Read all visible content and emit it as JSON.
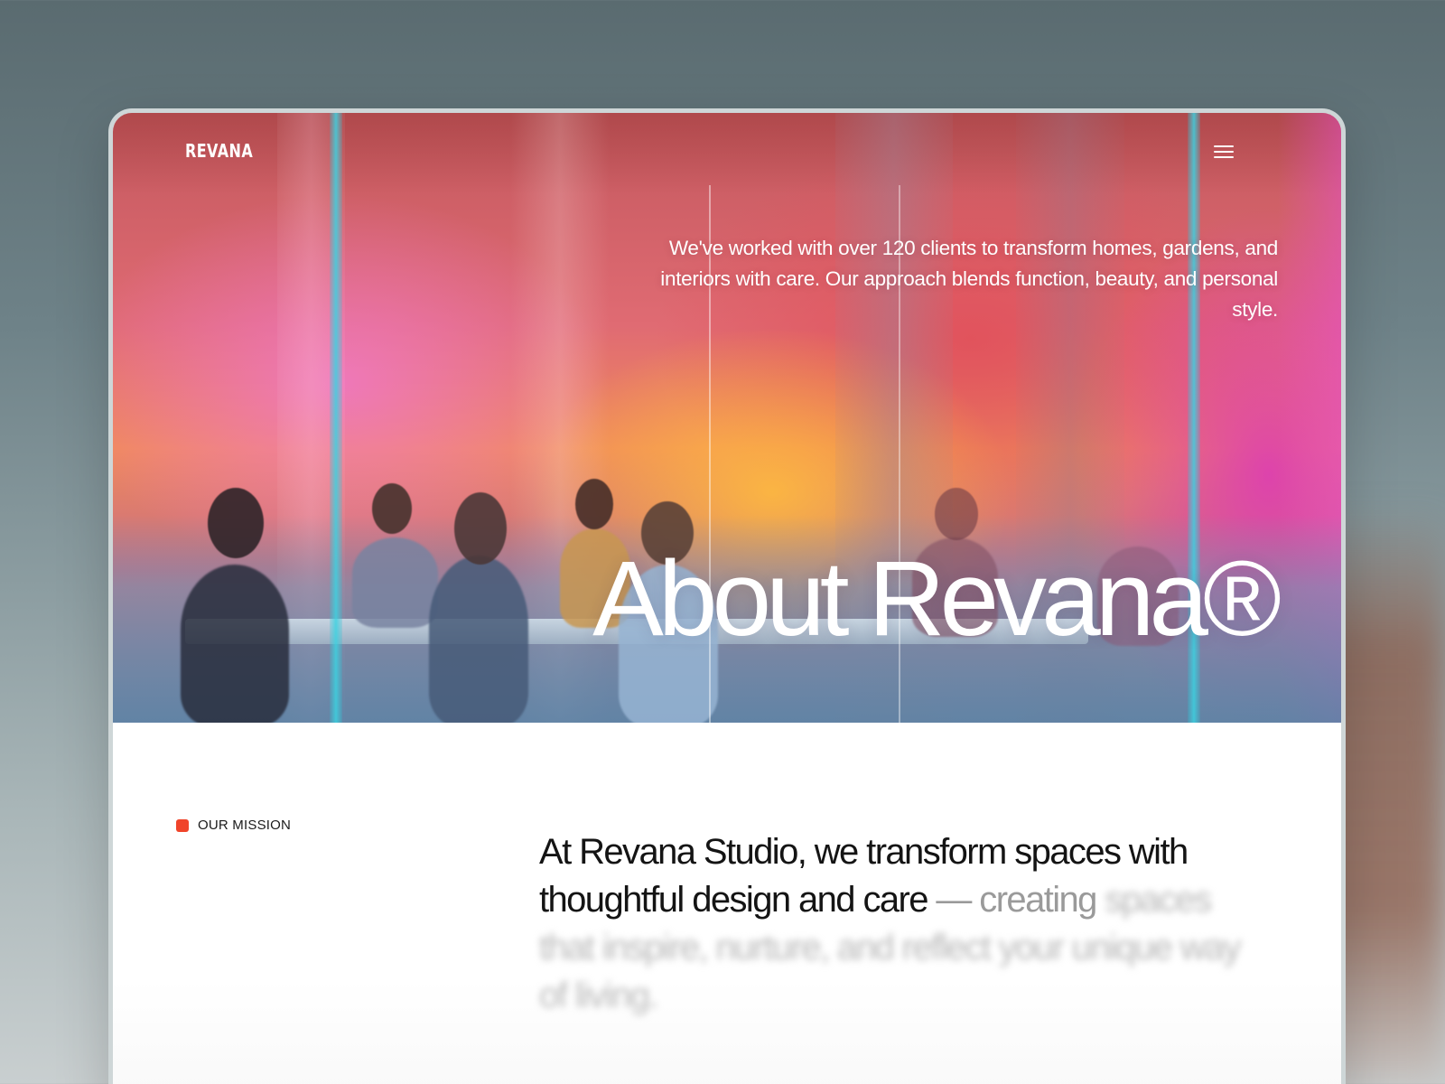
{
  "nav": {
    "brand": "REVANA",
    "menu_icon": "hamburger-menu-icon"
  },
  "hero": {
    "intro": "We've worked with over 120 clients to transform homes, gardens, and interiors with care. Our approach blends function, beauty, and personal style.",
    "title": "About Revana®",
    "image_subject": "team meeting in a glass-walled office with colorful light"
  },
  "mission": {
    "tag_label": "OUR MISSION",
    "text_primary": "At Revana Studio, we transform spaces with thoughtful design and care",
    "text_faded": " — creating",
    "text_blurred": " spaces that inspire, nurture, and reflect your unique way of living."
  },
  "colors": {
    "accent": "#f0442a",
    "text_dark": "#141414",
    "text_faded": "#9a9a9a"
  }
}
